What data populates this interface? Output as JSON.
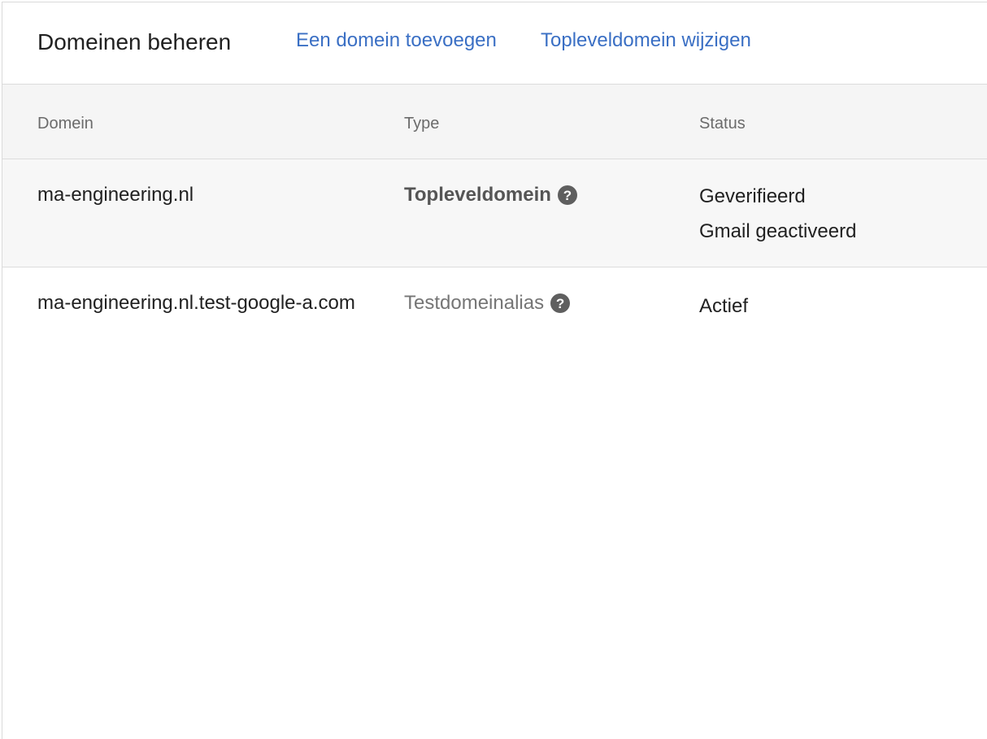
{
  "header": {
    "title": "Domeinen beheren",
    "add_domain_label": "Een domein toevoegen",
    "change_primary_label": "Topleveldomein wijzigen"
  },
  "table": {
    "columns": [
      "Domein",
      "Type",
      "Status"
    ],
    "rows": [
      {
        "domain": "ma-engineering.nl",
        "type": "Topleveldomein",
        "type_icon": "help-icon",
        "status": [
          "Geverifieerd",
          "Gmail geactiveerd"
        ]
      },
      {
        "domain": "ma-engineering.nl.test-google-a.com",
        "type": "Testdomeinalias",
        "type_icon": "help-icon",
        "status": [
          "Actief"
        ]
      }
    ]
  },
  "colors": {
    "link": "#3a6fc4",
    "header_background": "#f5f5f5",
    "help_icon": "#5f5f5f"
  }
}
